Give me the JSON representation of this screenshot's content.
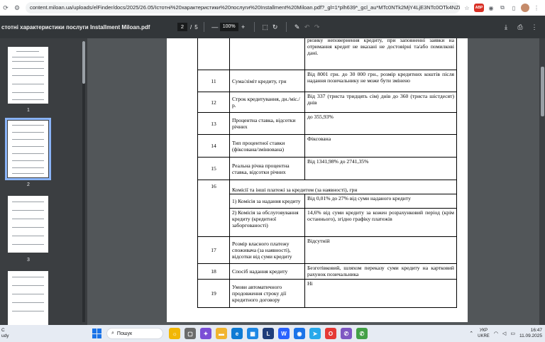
{
  "browser": {
    "url": "content.miloan.ua/uploads/elFinder/docs/2025/26.05/Істотні%20характеристики%20послуги%20Installment%20Miloan.pdf?_gl=1*plh639*_gcl_au*MTc0NTk2MjY4LjE3NTc0OTk4NZk.*_ga..."
  },
  "pdf_toolbar": {
    "title": "стотні характеристики послуги Installment Miloan.pdf",
    "current_page": "2",
    "page_sep": "/",
    "total_pages": "5",
    "zoom": "100%",
    "minus": "—",
    "plus": "+"
  },
  "thumbnails": [
    {
      "label": "1"
    },
    {
      "label": "2"
    },
    {
      "label": "3"
    },
    {
      "label": ""
    }
  ],
  "table": {
    "top_row": {
      "value": "ризику неповернення кредиту, при заповненні заявки на отримання кредит не вказані не достовірні та/або помилкові дані."
    },
    "rows": [
      {
        "num": "11",
        "name": "Сума/ліміт кредиту, грн",
        "value": "Від 8001 грн. до 30 000 грн., розмір кредитних коштів після надання позичальнику не може бути змінено"
      },
      {
        "num": "12",
        "name": "Строк кредитування, дн./міс./р.",
        "value": "Від 337 (триста тридцять сім) днів до 360 (триста шістдесят) днів"
      },
      {
        "num": "13",
        "name": "Процентна ставка, відсотки річних",
        "value": "до 355,93%"
      },
      {
        "num": "14",
        "name": "Тип процентної ставки (фіксована/змінювана)",
        "value": "Фіксована"
      },
      {
        "num": "15",
        "name": "Реальна річна процентна ставка, відсотки річних",
        "value": "Від 1341,98% до 2741,35%"
      }
    ],
    "row16": {
      "num": "16",
      "header": "Комісії та інші платежі за кредитом (за наявності), грн",
      "sub": [
        {
          "name": "1) Комісія за надання кредиту",
          "value": "Від 0,01% до 27%  від суми наданого кредиту"
        },
        {
          "name": "2) Комісія за обслуговування кредиту (кредитної заборгованості)",
          "value": "14,6% від суми кредиту за кожен розрахунковий період (крім останнього), згідно графіку платежів"
        }
      ]
    },
    "rows_after": [
      {
        "num": "17",
        "name": "Розмір власного платежу споживача (за наявності), відсотки від суми кредиту",
        "value": "Відсутній"
      },
      {
        "num": "18",
        "name": "Спосіб надання кредиту",
        "value": "Безготівковий, шляхом переказу суми кредиту на картковий рахунок позичальника"
      },
      {
        "num": "19",
        "name": "Умови автоматичного продовження строку дії кредитного договору",
        "value": "Ні"
      }
    ]
  },
  "taskbar": {
    "weather_temp": "С",
    "weather_text": "udy",
    "search_placeholder": "Пошук",
    "lang_top": "УКР",
    "lang_bottom": "UKRE",
    "time": "16:47",
    "date": "11.09.2025"
  },
  "colors": {
    "pdf_toolbar": "#323639",
    "sidebar": "#3b3e41",
    "viewer_bg": "#525659",
    "selected_thumb": "#8ab4f8"
  }
}
